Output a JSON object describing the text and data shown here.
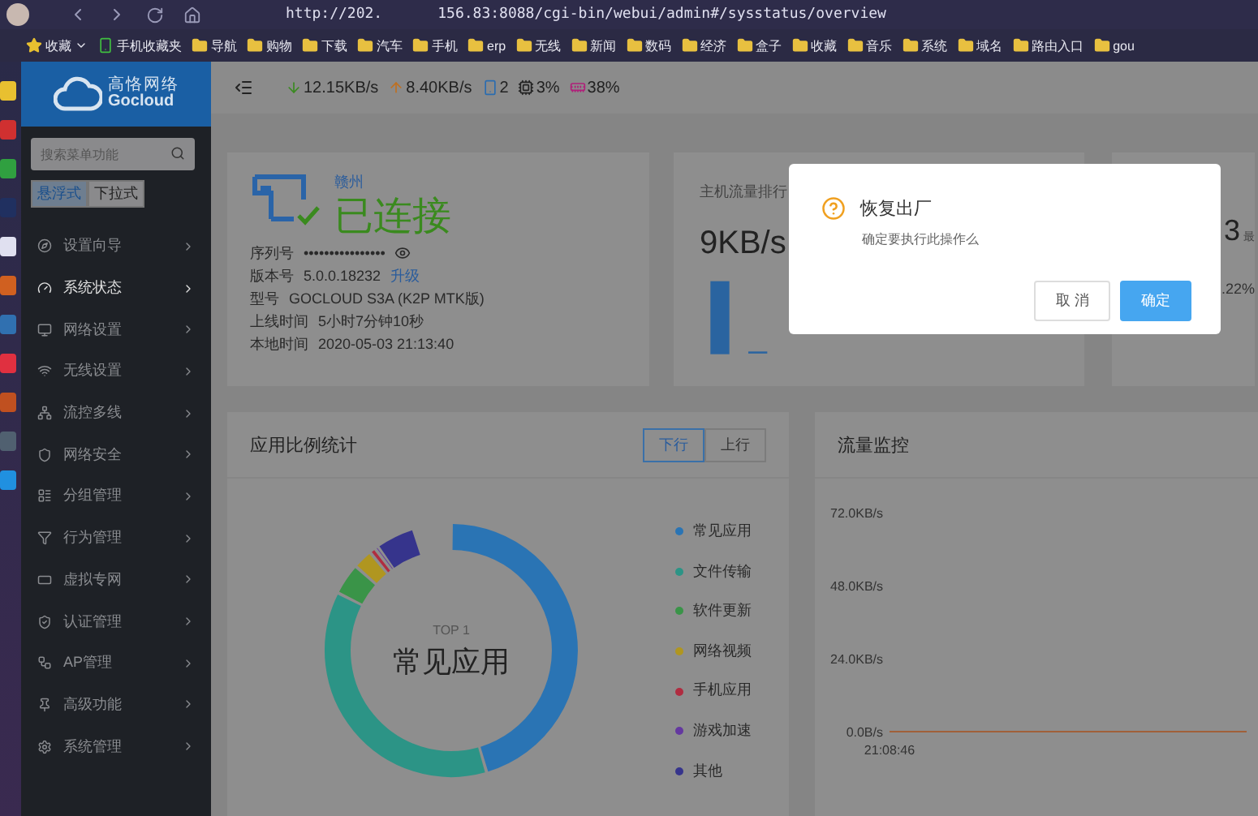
{
  "browser": {
    "url_start": "http://202.",
    "url_end": "156.83:8088/cgi-bin/webui/admin#/sysstatus/overview",
    "bookmarks": [
      {
        "label": "收藏",
        "kind": "star"
      },
      {
        "label": "手机收藏夹",
        "kind": "mobile"
      },
      {
        "label": "导航",
        "kind": "folder"
      },
      {
        "label": "购物",
        "kind": "folder"
      },
      {
        "label": "下载",
        "kind": "folder"
      },
      {
        "label": "汽车",
        "kind": "folder"
      },
      {
        "label": "手机",
        "kind": "folder"
      },
      {
        "label": "erp",
        "kind": "folder"
      },
      {
        "label": "无线",
        "kind": "folder"
      },
      {
        "label": "新闻",
        "kind": "folder"
      },
      {
        "label": "数码",
        "kind": "folder"
      },
      {
        "label": "经济",
        "kind": "folder"
      },
      {
        "label": "盒子",
        "kind": "folder"
      },
      {
        "label": "收藏",
        "kind": "folder"
      },
      {
        "label": "音乐",
        "kind": "folder"
      },
      {
        "label": "系统",
        "kind": "folder"
      },
      {
        "label": "域名",
        "kind": "folder"
      },
      {
        "label": "路由入口",
        "kind": "folder"
      },
      {
        "label": "gou",
        "kind": "folder"
      }
    ]
  },
  "sidebar": {
    "brand": "高恪网络",
    "brand_sub": "Gocloud",
    "search": {
      "placeholder": "搜索菜单功能"
    },
    "modes": [
      {
        "label": "悬浮式",
        "selected": true
      },
      {
        "label": "下拉式",
        "selected": false
      }
    ],
    "items": [
      {
        "label": "设置向导",
        "selected": false
      },
      {
        "label": "系统状态",
        "selected": true
      },
      {
        "label": "网络设置",
        "selected": false
      },
      {
        "label": "无线设置",
        "selected": false
      },
      {
        "label": "流控多线",
        "selected": false
      },
      {
        "label": "网络安全",
        "selected": false
      },
      {
        "label": "分组管理",
        "selected": false
      },
      {
        "label": "行为管理",
        "selected": false
      },
      {
        "label": "虚拟专网",
        "selected": false
      },
      {
        "label": "认证管理",
        "selected": false
      },
      {
        "label": "AP管理",
        "selected": false
      },
      {
        "label": "高级功能",
        "selected": false
      },
      {
        "label": "系统管理",
        "selected": false
      }
    ]
  },
  "header": {
    "download": "12.15KB/s",
    "upload": "8.40KB/s",
    "devices": "2",
    "cpu": "3%",
    "memory": "38%"
  },
  "device_card": {
    "location": "赣州",
    "status": "已连接",
    "connected": true,
    "rows": [
      {
        "label": "序列号",
        "value": "••••••••••••••••",
        "kind": "secret"
      },
      {
        "label": "版本号",
        "value": "5.0.0.18232",
        "link": "升级",
        "kind": "link"
      },
      {
        "label": "型号",
        "value": "GOCLOUD S3A (K2P MTK版)",
        "kind": "text"
      },
      {
        "label": "上线时间",
        "value": "5小时7分钟10秒",
        "kind": "text"
      },
      {
        "label": "本地时间",
        "value": "2020-05-03 21:13:40",
        "kind": "text"
      }
    ]
  },
  "host_card": {
    "title": "主机流量排行",
    "value": "9KB/s"
  },
  "third_card": {
    "value": "3",
    "label": "最",
    "percent": ".22%"
  },
  "app_card": {
    "title": "应用比例统计",
    "direction_tabs": [
      {
        "label": "下行",
        "selected": true
      },
      {
        "label": "上行",
        "selected": false
      }
    ],
    "top_label": "TOP 1",
    "top_name": "常见应用",
    "legend": [
      {
        "label": "常见应用",
        "color": "#2a74b4"
      },
      {
        "label": "文件传输",
        "color": "#2c9486"
      },
      {
        "label": "软件更新",
        "color": "#3a9448"
      },
      {
        "label": "网络视频",
        "color": "#b09620"
      },
      {
        "label": "手机应用",
        "color": "#b02c40"
      },
      {
        "label": "游戏加速",
        "color": "#6438a0"
      },
      {
        "label": "其他",
        "color": "#36348c"
      }
    ]
  },
  "traffic_card": {
    "title": "流量监控",
    "chart_data": {
      "type": "line",
      "ylim": [
        0,
        72
      ],
      "series": [
        {
          "color": "#a0603a",
          "values": [
            0,
            0,
            0,
            0,
            0,
            0,
            0,
            0,
            0,
            0
          ]
        }
      ],
      "yticks": [
        {
          "value": 0,
          "label": "0.0B/s"
        },
        {
          "value": 24,
          "label": "24.0KB/s"
        },
        {
          "value": 48,
          "label": "48.0KB/s"
        },
        {
          "value": 72,
          "label": "72.0KB/s"
        }
      ],
      "annotations": [
        {
          "text": "21:08:46"
        }
      ]
    }
  },
  "dialog": {
    "title": "恢复出厂",
    "message": "确定要执行此操作么",
    "buttons": [
      {
        "label": "取 消",
        "kind": "cancel"
      },
      {
        "label": "确定",
        "kind": "primary"
      }
    ]
  }
}
